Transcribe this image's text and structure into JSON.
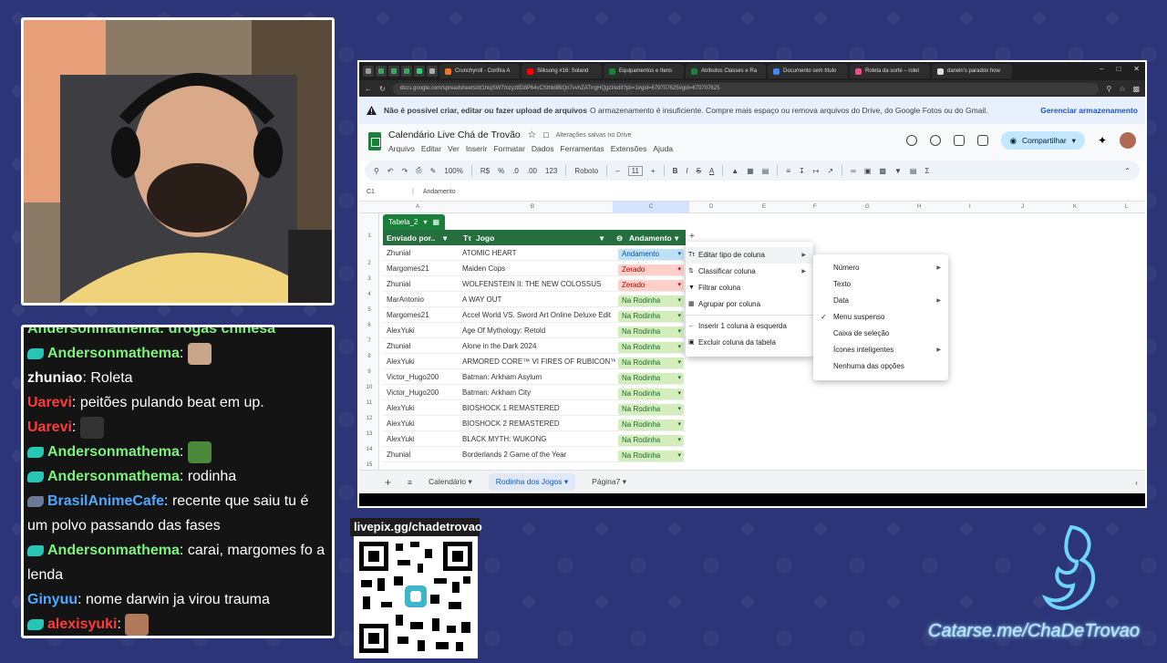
{
  "colors": {
    "background": "#2c3577",
    "sheets_green": "#188038",
    "table_header": "#256e3e",
    "accent_blue": "#0b57d0"
  },
  "chat": {
    "messages": [
      {
        "user": "Andersonmathema",
        "text": "",
        "emote": true
      },
      {
        "user": "zhuniao",
        "text": "Roleta"
      },
      {
        "user": "Uarevi",
        "text": "peitões pulando beat em up."
      },
      {
        "user": "Uarevi",
        "text": "",
        "emote": true
      },
      {
        "user": "Andersonmathema",
        "text": "",
        "emote": true
      },
      {
        "user": "Andersonmathema",
        "text": "rodinha"
      },
      {
        "user": "BrasilAnimeCafe",
        "text": "recente que saiu tu é um polvo passando das fases"
      },
      {
        "user": "Andersonmathema",
        "text": "carai, margomes fo a lenda"
      },
      {
        "user": "Ginyuu",
        "text": "nome darwin ja virou trauma"
      },
      {
        "user": "alexisyuki",
        "text": "",
        "emote": true
      }
    ]
  },
  "donation": {
    "label": "livepix.gg/chadetrovao"
  },
  "branding": {
    "catarse": "Catarse.me/ChaDeTrovao"
  },
  "browser": {
    "tabs": [
      "Crunchyroll - Confira A",
      "Silksong #16: Soland",
      "Equipamentos e Itens",
      "Atributos Classes e Ra",
      "Documento sem título",
      "Roleta da sorte – rolet",
      "darwin's paradox how"
    ],
    "url": "docs.google.com/spreadsheets/d/1hlqSW7mzyz8D8P64vCSthbIlBiQn7vvhZATrrgHQgzI/edit?pli=1#gid=679707625#gid=679707625"
  },
  "banner": {
    "bold": "Não é possível criar, editar ou fazer upload de arquivos",
    "text": "O armazenamento é insuficiente. Compre mais espaço ou remova arquivos do Drive, do Google Fotos ou do Gmail.",
    "action": "Gerenciar armazenamento"
  },
  "doc": {
    "title": "Calendário Live Chá de Trovão",
    "saved": "Alterações salvas no Drive",
    "menus": [
      "Arquivo",
      "Editar",
      "Ver",
      "Inserir",
      "Formatar",
      "Dados",
      "Ferramentas",
      "Extensões",
      "Ajuda"
    ],
    "share": "Compartilhar"
  },
  "toolbar": {
    "zoom": "100%",
    "currency": "R$",
    "percent": "%",
    "decimals_less": ".0",
    "decimals_more": ".00",
    "format123": "123",
    "font": "Roboto",
    "font_size": "11",
    "bold": "B",
    "italic": "I",
    "strike": "S",
    "text_color": "A"
  },
  "formula": {
    "cell": "C1",
    "value": "Andamento"
  },
  "columns": [
    "A",
    "B",
    "C",
    "D",
    "E",
    "F",
    "G",
    "H",
    "I",
    "J",
    "K",
    "L"
  ],
  "table": {
    "name": "Tabela_2",
    "headers": [
      "Enviado por..",
      "Jogo",
      "Andamento"
    ],
    "rows": [
      {
        "n": "2",
        "by": "Zhunial",
        "game": "ATOMIC HEART",
        "status": "Andamento",
        "tone": "b"
      },
      {
        "n": "3",
        "by": "Margomes21",
        "game": "Maiden Cops",
        "status": "Zerado",
        "tone": "r"
      },
      {
        "n": "4",
        "by": "Zhunial",
        "game": "WOLFENSTEIN II: THE NEW COLOSSUS",
        "status": "Zerado",
        "tone": "r"
      },
      {
        "n": "5",
        "by": "MarAntonio",
        "game": "A WAY OUT",
        "status": "Na Rodinha",
        "tone": "g"
      },
      {
        "n": "6",
        "by": "Margomes21",
        "game": "Accel World VS. Sword Art Online Deluxe Edit",
        "status": "Na Rodinha",
        "tone": "g"
      },
      {
        "n": "7",
        "by": "AlexYuki",
        "game": "Age Of Mythology: Retold",
        "status": "Na Rodinha",
        "tone": "g"
      },
      {
        "n": "8",
        "by": "Zhunial",
        "game": "Alone in the Dark 2024",
        "status": "Na Rodinha",
        "tone": "g"
      },
      {
        "n": "9",
        "by": "AlexYuki",
        "game": "ARMORED CORE™ VI FIRES OF RUBICON™",
        "status": "Na Rodinha",
        "tone": "g"
      },
      {
        "n": "10",
        "by": "Victor_Hugo200",
        "game": "Batman: Arkham Asylum",
        "status": "Na Rodinha",
        "tone": "g"
      },
      {
        "n": "11",
        "by": "Victor_Hugo200",
        "game": "Batman: Arkham City",
        "status": "Na Rodinha",
        "tone": "g"
      },
      {
        "n": "12",
        "by": "AlexYuki",
        "game": "BIOSHOCK 1 REMASTERED",
        "status": "Na Rodinha",
        "tone": "g"
      },
      {
        "n": "13",
        "by": "AlexYuki",
        "game": "BIOSHOCK 2 REMASTERED",
        "status": "Na Rodinha",
        "tone": "g"
      },
      {
        "n": "14",
        "by": "AlexYuki",
        "game": "BLACK MYTH: WUKONG",
        "status": "Na Rodinha",
        "tone": "g"
      },
      {
        "n": "15",
        "by": "Zhunial",
        "game": "Borderlands 2 Game of the Year",
        "status": "Na Rodinha",
        "tone": "g"
      }
    ]
  },
  "context_menu": {
    "items": [
      "Editar tipo de coluna",
      "Classificar coluna",
      "Filtrar coluna",
      "Agrupar por coluna",
      "Inserir 1 coluna à esquerda",
      "Excluir coluna da tabela"
    ]
  },
  "submenu": {
    "items": [
      "Número",
      "Texto",
      "Data",
      "Menu suspenso",
      "Caixa de seleção",
      "Ícones inteligentes",
      "Nenhuma das opções"
    ],
    "checked": "Menu suspenso"
  },
  "sheets": [
    "Calendário",
    "Rodinha dos Jogos",
    "Página7"
  ]
}
